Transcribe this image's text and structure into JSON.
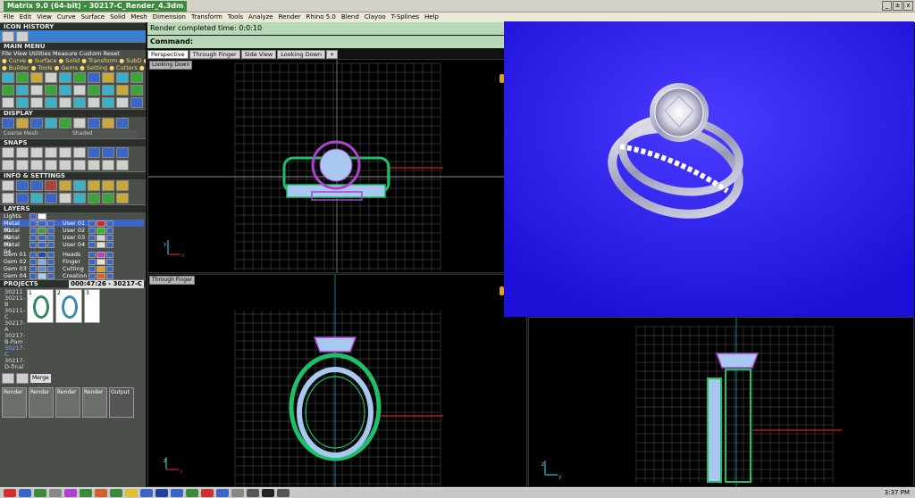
{
  "title": "Matrix 9.0 (64-bit) - 30217-C_Render_4.3dm",
  "window_buttons": [
    "_",
    "±",
    "x"
  ],
  "menu": [
    "File",
    "Edit",
    "View",
    "Curve",
    "Surface",
    "Solid",
    "Mesh",
    "Dimension",
    "Transform",
    "Tools",
    "Analyze",
    "Render",
    "Rhino 5.0",
    "Blend",
    "Clayoo",
    "T-Splines",
    "Help"
  ],
  "sections": {
    "icon_history": "ICON HISTORY",
    "main_menu": "MAIN MENU",
    "display": "DISPLAY",
    "snaps": "SNAPS",
    "info": "INFO & SETTINGS",
    "layers": "LAYERS",
    "projects": "PROJECTS"
  },
  "main_menu_lines": [
    "File  View  Utilities  Measure  Custom         Reset",
    "● Curve ● Surface ● Solid ● Transform ● SubD    ● Art",
    "● Builder ● Tools ● Gems ● Setting ● Cutters ● Render"
  ],
  "display": {
    "mesh": "Coarse Mesh",
    "shade": "Shaded"
  },
  "layers": {
    "lights": "Lights",
    "left": [
      "Metal 01",
      "Metal 02",
      "Metal 03",
      "Metal 04",
      "Gem 01",
      "Gem 02",
      "Gem 03",
      "Gem 04"
    ],
    "right": [
      "User 01",
      "User 02",
      "User 03",
      "User 04",
      "Heads",
      "Finger",
      "Cutting",
      "Creation"
    ],
    "left_colors": [
      "#3a66c9",
      "#3aa33a",
      "#3a66c9",
      "#3a66c9",
      "#2244bb",
      "#88aadd",
      "#6688cc",
      "#aaccee"
    ],
    "right_colors": [
      "#e02020",
      "#20c020",
      "#d0d0d0",
      "#e0e0e0",
      "#c040c0",
      "#e0e0e0",
      "#e0a020",
      "#e06020"
    ]
  },
  "projects": {
    "timer": "000:47:26 - 30217-C",
    "items": [
      "30211",
      "30211-B",
      "30211-C",
      "30217-A",
      "30217-B-Pam",
      "30217-C",
      "30217-D-final"
    ],
    "selected": "30217-C",
    "thumb_numbers": [
      "1",
      "2",
      "3"
    ],
    "merge": "Merge",
    "render_tabs": [
      "Render",
      "Render",
      "Render",
      "Render"
    ],
    "output": "Output"
  },
  "render_status": "Render completed time: 0:0:10",
  "command_label": "Command:",
  "view_tabs": [
    "Perspective",
    "Through Finger",
    "Side View",
    "Looking Down"
  ],
  "viewport_labels": {
    "top": "Looking Down",
    "bottom": "Through Finger"
  },
  "axes": {
    "x": "x",
    "y": "y",
    "z": "z"
  },
  "colors": {
    "render_bg": "#2a1cf0",
    "status_bg": "#b7d9b7",
    "green": "#1fbf6a",
    "purple": "#b040d0",
    "gem_blue": "#a8c8f0"
  },
  "clock": "3:37 PM"
}
